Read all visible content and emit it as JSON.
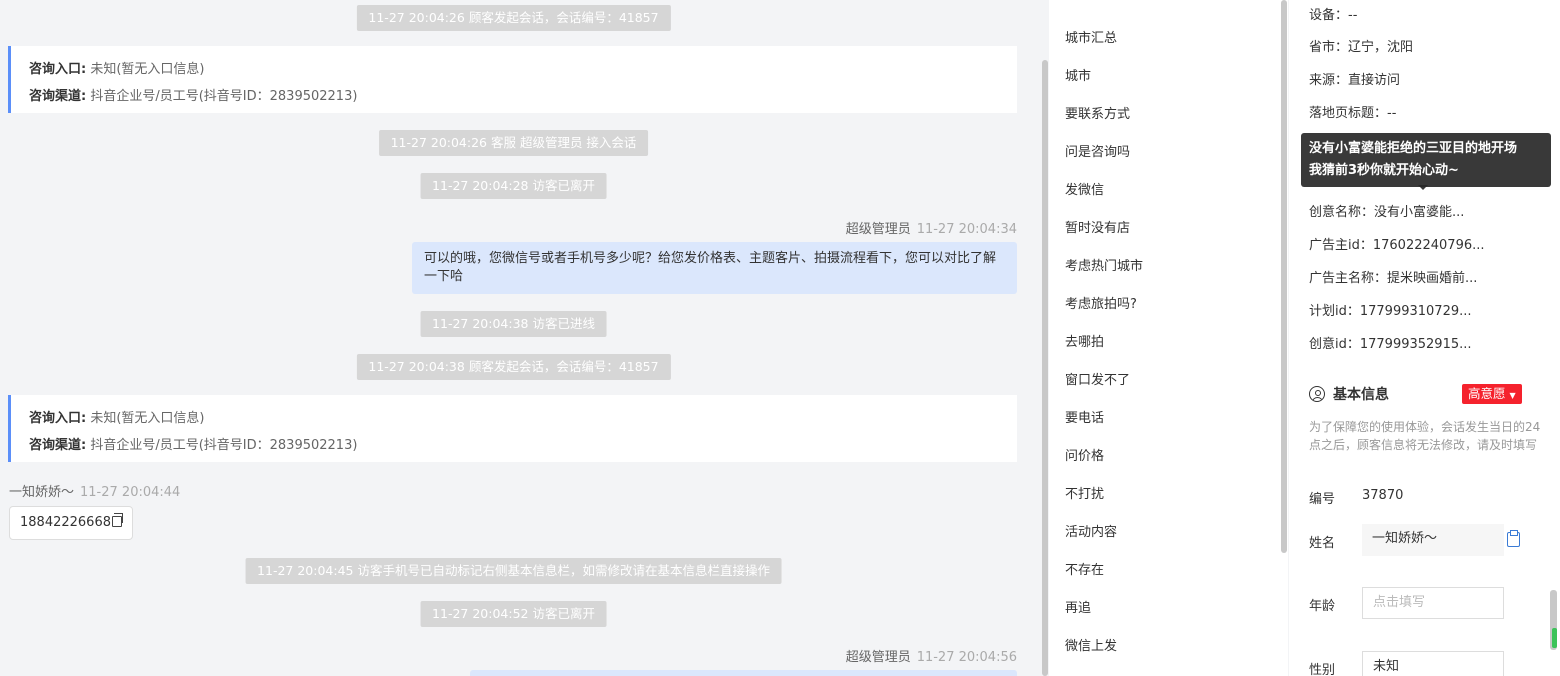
{
  "chat": {
    "sys1": "11-27 20:04:26 顾客发起会话，会话编号：41857",
    "card1": {
      "entry_label": "咨询入口:",
      "entry_value": "未知(暂无入口信息)",
      "channel_label": "咨询渠道:",
      "channel_value": "抖音企业号/员工号(抖音号ID：2839502213)"
    },
    "sys2": "11-27 20:04:26 客服 超级管理员 接入会话",
    "sys3": "11-27 20:04:28 访客已离开",
    "agent1": {
      "name": "超级管理员",
      "time": "11-27 20:04:34"
    },
    "msg_out1": "可以的哦，您微信号或者手机号多少呢？给您发价格表、主题客片、拍摄流程看下，您可以对比了解一下哈",
    "sys4": "11-27 20:04:38 访客已进线",
    "sys5": "11-27 20:04:38 顾客发起会话，会话编号：41857",
    "card2": {
      "entry_label": "咨询入口:",
      "entry_value": "未知(暂无入口信息)",
      "channel_label": "咨询渠道:",
      "channel_value": "抖音企业号/员工号(抖音号ID：2839502213)"
    },
    "visitor1": {
      "name": "一知娇娇～",
      "time": "11-27 20:04:44"
    },
    "msg_in1": "18842226668",
    "sys6": "11-27 20:04:45 访客手机号已自动标记右侧基本信息栏，如需修改请在基本信息栏直接操作",
    "sys7": "11-27 20:04:52 访客已离开",
    "agent2": {
      "name": "超级管理员",
      "time": "11-27 20:04:56"
    }
  },
  "quick_replies": {
    "items": [
      "城市汇总",
      "城市",
      "要联系方式",
      "问是咨询吗",
      "发微信",
      "暂时没有店",
      "考虑热门城市",
      "考虑旅拍吗?",
      "去哪拍",
      "窗口发不了",
      "要电话",
      "问价格",
      "不打扰",
      "活动内容",
      "不存在",
      "再追",
      "微信上发"
    ]
  },
  "visitor_info": {
    "device": "设备：--",
    "province": "省市：辽宁，沈阳",
    "source": "来源：直接访问",
    "landing_title": "落地页标题：--",
    "creative_name": "创意名称：没有小富婆能...",
    "advertiser_id": "广告主id：176022240796...",
    "advertiser_name": "广告主名称：提米映画婚前...",
    "plan_id": "计划id：177999310729...",
    "creative_id": "创意id：177999352915..."
  },
  "tooltip": {
    "line1": "没有小富婆能拒绝的三亚目的地开场",
    "line2": "我猜前3秒你就开始心动~"
  },
  "basic_info": {
    "title": "基本信息",
    "intent_badge": "高意愿",
    "notice": "为了保障您的使用体验，会话发生当日的24点之后，顾客信息将无法修改，请及时填写",
    "id_label": "编号",
    "id_value": "37870",
    "name_label": "姓名",
    "name_value": "一知娇娇～",
    "age_label": "年龄",
    "age_placeholder": "点击填写",
    "gender_label": "性别",
    "gender_value": "未知"
  },
  "colors": {
    "accent": "#5b8ff9",
    "badge": "#f5222d",
    "bubble_out": "#dbe7fc"
  }
}
